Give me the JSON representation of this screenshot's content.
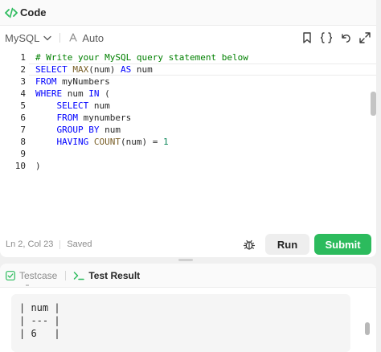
{
  "header": {
    "title": "Code"
  },
  "toolbar": {
    "language": "MySQL",
    "auto_label": "Auto"
  },
  "editor": {
    "lines": [
      {
        "num": "1",
        "segments": [
          {
            "t": "# Write your MySQL query statement below",
            "c": "comment"
          }
        ]
      },
      {
        "num": "2",
        "segments": [
          {
            "t": "SELECT ",
            "c": "kw"
          },
          {
            "t": "MAX",
            "c": "fn"
          },
          {
            "t": "(num) ",
            "c": ""
          },
          {
            "t": "AS",
            "c": "kw"
          },
          {
            "t": " num",
            "c": ""
          }
        ]
      },
      {
        "num": "3",
        "segments": [
          {
            "t": "FROM",
            "c": "kw"
          },
          {
            "t": " myNumbers",
            "c": ""
          }
        ]
      },
      {
        "num": "4",
        "segments": [
          {
            "t": "WHERE",
            "c": "kw"
          },
          {
            "t": " num ",
            "c": ""
          },
          {
            "t": "IN",
            "c": "kw"
          },
          {
            "t": " (",
            "c": ""
          }
        ]
      },
      {
        "num": "5",
        "segments": [
          {
            "t": "    ",
            "c": ""
          },
          {
            "t": "SELECT",
            "c": "kw"
          },
          {
            "t": " num",
            "c": ""
          }
        ]
      },
      {
        "num": "6",
        "segments": [
          {
            "t": "    ",
            "c": ""
          },
          {
            "t": "FROM",
            "c": "kw"
          },
          {
            "t": " mynumbers",
            "c": ""
          }
        ]
      },
      {
        "num": "7",
        "segments": [
          {
            "t": "    ",
            "c": ""
          },
          {
            "t": "GROUP BY",
            "c": "kw"
          },
          {
            "t": " num",
            "c": ""
          }
        ]
      },
      {
        "num": "8",
        "segments": [
          {
            "t": "    ",
            "c": ""
          },
          {
            "t": "HAVING",
            "c": "kw"
          },
          {
            "t": " ",
            "c": ""
          },
          {
            "t": "COUNT",
            "c": "fn"
          },
          {
            "t": "(num) = ",
            "c": ""
          },
          {
            "t": "1",
            "c": "num"
          }
        ]
      },
      {
        "num": "9",
        "segments": []
      },
      {
        "num": "10",
        "segments": [
          {
            "t": ")",
            "c": ""
          }
        ]
      }
    ]
  },
  "status": {
    "position": "Ln 2, Col 23",
    "saved": "Saved"
  },
  "buttons": {
    "run": "Run",
    "submit": "Submit"
  },
  "bottom_tabs": {
    "testcase": "Testcase",
    "test_result": "Test Result"
  },
  "result": {
    "lines": [
      "| num |",
      "| --- |",
      "| 6   |"
    ]
  },
  "colors": {
    "submit_bg": "#2cbb5d",
    "keyword": "#0000ff",
    "comment": "#008000",
    "function": "#795e26",
    "number": "#098658"
  },
  "icons": [
    "code-icon",
    "chevron-down-icon",
    "auto-icon",
    "bookmark-icon",
    "braces-icon",
    "undo-icon",
    "fullscreen-icon",
    "bug-icon",
    "checkbox-icon",
    "terminal-icon"
  ]
}
